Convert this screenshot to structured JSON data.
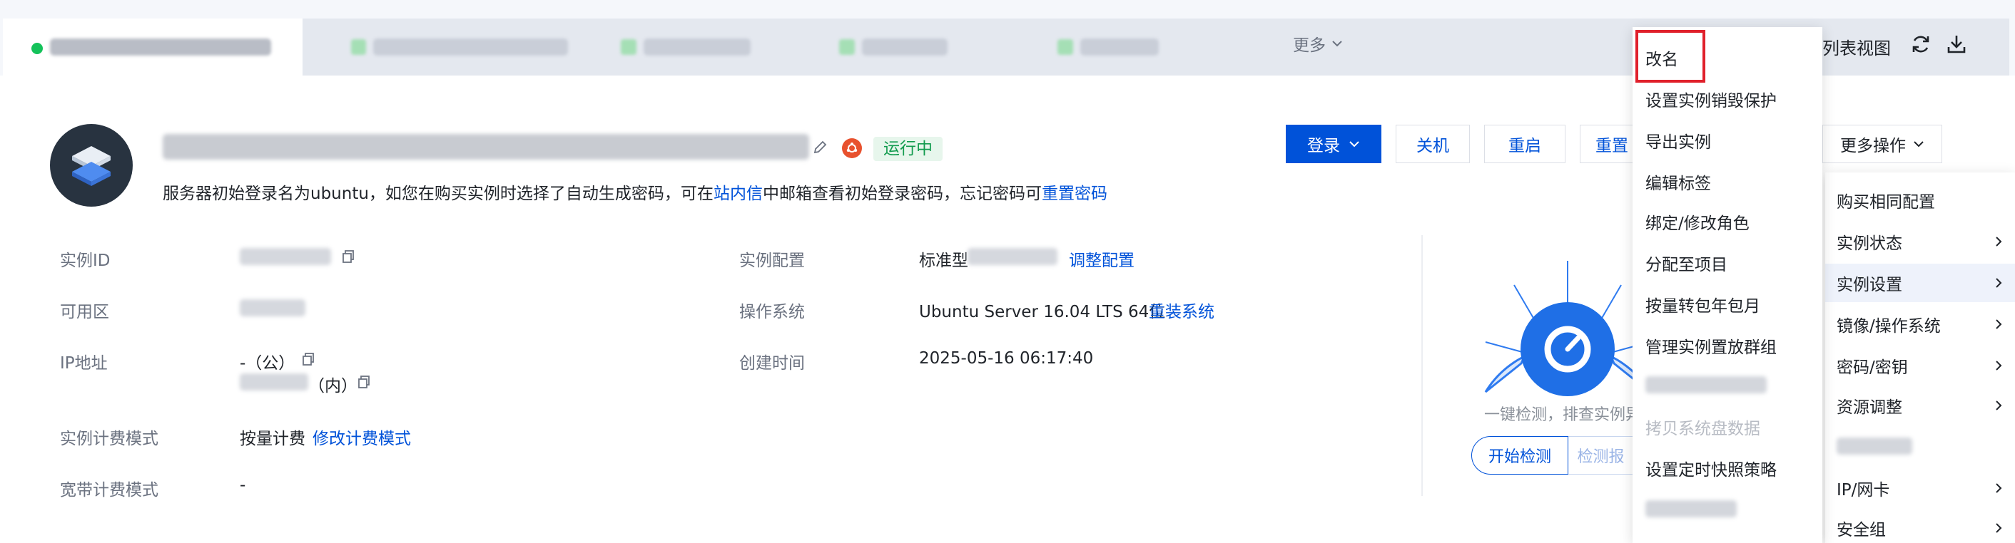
{
  "tabs": {
    "more_label": "更多",
    "list_view_label": "列表视图"
  },
  "header": {
    "status": "运行中",
    "notice_prefix": "服务器初始登录名为ubuntu，如您在购买实例时选择了自动生成密码，可在",
    "notice_link1": "站内信",
    "notice_middle": "中邮箱查看初始登录密码，忘记密码可",
    "notice_link2": "重置密码"
  },
  "actions": {
    "login": "登录",
    "shutdown": "关机",
    "restart": "重启",
    "reset": "重置",
    "more_ops": "更多操作"
  },
  "info": {
    "instance_id_label": "实例ID",
    "zone_label": "可用区",
    "ip_label": "IP地址",
    "ip_public_value": "-（公）",
    "ip_private_suffix": "（内）",
    "billing_label": "实例计费模式",
    "billing_value": "按量计费",
    "billing_link": "修改计费模式",
    "bandwidth_label": "宽带计费模式",
    "bandwidth_value": "-",
    "config_label": "实例配置",
    "config_value": "标准型",
    "config_link": "调整配置",
    "os_label": "操作系统",
    "os_value": "Ubuntu Server 16.04 LTS 64位",
    "os_link": "重装系统",
    "created_label": "创建时间",
    "created_value": "2025-05-16 06:17:40"
  },
  "check": {
    "description": "一键检测，排查实例异",
    "start_button": "开始检测",
    "report_button": "检测报"
  },
  "dropdown": {
    "items": [
      "改名",
      "设置实例销毁保护",
      "导出实例",
      "编辑标签",
      "绑定/修改角色",
      "分配至项目",
      "按量转包年包月",
      "管理实例置放群组",
      "拷贝系统盘数据",
      "设置定时快照策略"
    ]
  },
  "submenu": {
    "items": [
      "购买相同配置",
      "实例状态",
      "实例设置",
      "镜像/操作系统",
      "密码/密钥",
      "资源调整",
      "IP/网卡",
      "安全组"
    ]
  },
  "colors": {
    "primary": "#0052d9",
    "running_green": "#129b4e",
    "highlight_red": "#e0202b",
    "ubuntu_orange": "#e8512e"
  }
}
